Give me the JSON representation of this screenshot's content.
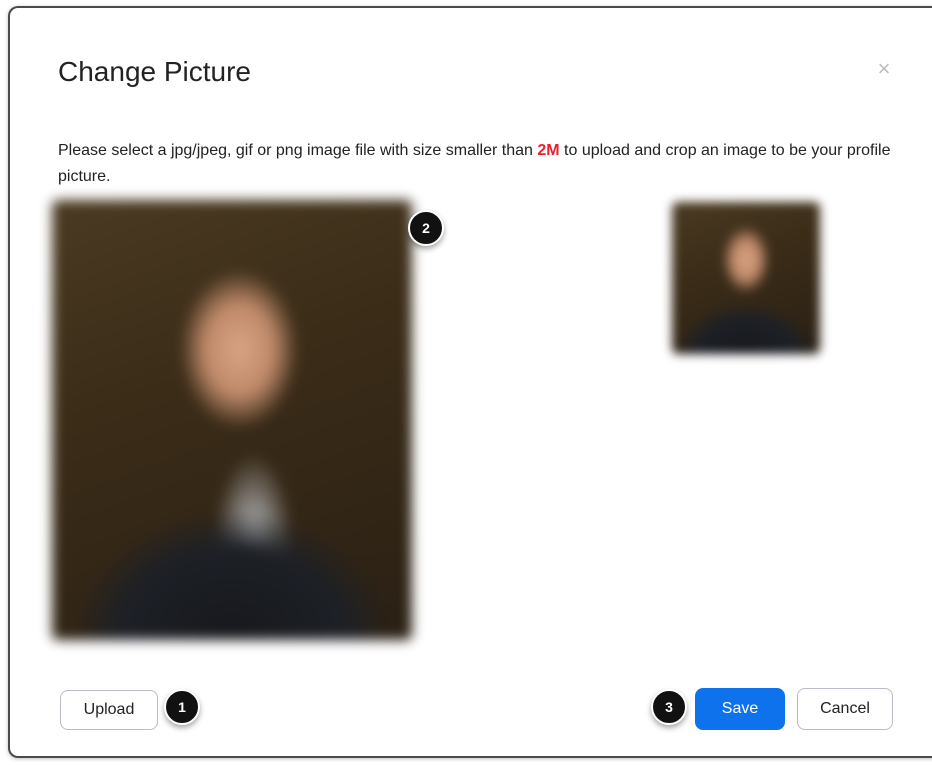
{
  "dialog": {
    "title": "Change Picture",
    "close_symbol": "×",
    "description_before": "Please select a jpg/jpeg, gif or png image file with size smaller than ",
    "description_highlight": "2M",
    "description_after": " to upload and crop an image to be your profile picture."
  },
  "badges": {
    "upload": "1",
    "crop": "2",
    "save": "3"
  },
  "buttons": {
    "upload_label": "Upload",
    "save_label": "Save",
    "cancel_label": "Cancel"
  },
  "colors": {
    "primary": "#0e72ed",
    "highlight": "#e8212a"
  },
  "icons": {
    "close": "close-icon"
  }
}
